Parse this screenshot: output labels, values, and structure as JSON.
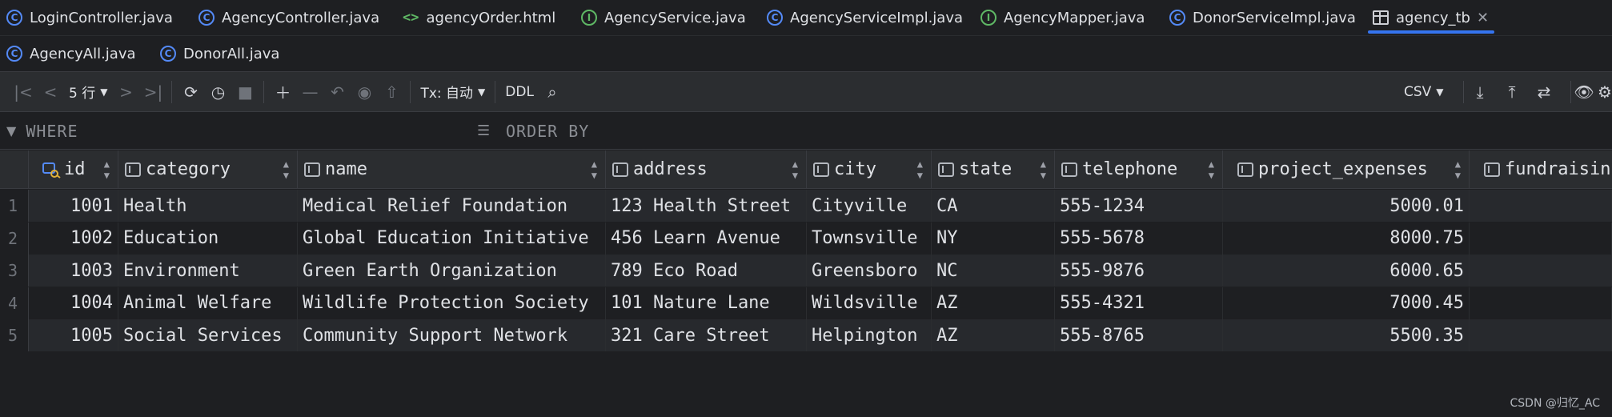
{
  "tabs_row1": [
    {
      "label": "LoginController.java",
      "icon": "class-icon"
    },
    {
      "label": "AgencyController.java",
      "icon": "class-icon"
    },
    {
      "label": "agencyOrder.html",
      "icon": "html-icon"
    },
    {
      "label": "AgencyService.java",
      "icon": "interface-icon"
    },
    {
      "label": "AgencyServiceImpl.java",
      "icon": "class-icon"
    },
    {
      "label": "AgencyMapper.java",
      "icon": "interface-icon"
    },
    {
      "label": "DonorServiceImpl.java",
      "icon": "class-icon"
    },
    {
      "label": "agency_tb",
      "icon": "table-icon",
      "active": true
    }
  ],
  "tabs_row2": [
    {
      "label": "AgencyAll.java",
      "icon": "class-icon"
    },
    {
      "label": "DonorAll.java",
      "icon": "class-icon"
    }
  ],
  "toolbar": {
    "rows_label": "5 行",
    "tx_label": "Tx: 自动",
    "ddl_label": "DDL",
    "export_format": "CSV"
  },
  "filter": {
    "where_label": "WHERE",
    "orderby_label": "ORDER BY"
  },
  "columns": [
    "id",
    "category",
    "name",
    "address",
    "city",
    "state",
    "telephone",
    "project_expenses",
    "fundraisin"
  ],
  "rows": [
    {
      "n": "1",
      "id": "1001",
      "category": "Health",
      "name": "Medical Relief Foundation",
      "address": "123 Health Street",
      "city": "Cityville",
      "state": "CA",
      "telephone": "555-1234",
      "project_expenses": "5000.01"
    },
    {
      "n": "2",
      "id": "1002",
      "category": "Education",
      "name": "Global Education Initiative",
      "address": "456 Learn Avenue",
      "city": "Townsville",
      "state": "NY",
      "telephone": "555-5678",
      "project_expenses": "8000.75"
    },
    {
      "n": "3",
      "id": "1003",
      "category": "Environment",
      "name": "Green Earth Organization",
      "address": "789 Eco Road",
      "city": "Greensboro",
      "state": "NC",
      "telephone": "555-9876",
      "project_expenses": "6000.65"
    },
    {
      "n": "4",
      "id": "1004",
      "category": "Animal Welfare",
      "name": "Wildlife Protection Society",
      "address": "101 Nature Lane",
      "city": "Wildsville",
      "state": "AZ",
      "telephone": "555-4321",
      "project_expenses": "7000.45"
    },
    {
      "n": "5",
      "id": "1005",
      "category": "Social Services",
      "name": "Community Support Network",
      "address": "321 Care Street",
      "city": "Helpington",
      "state": "AZ",
      "telephone": "555-8765",
      "project_expenses": "5500.35"
    }
  ],
  "watermark": "CSDN @归忆_AC"
}
